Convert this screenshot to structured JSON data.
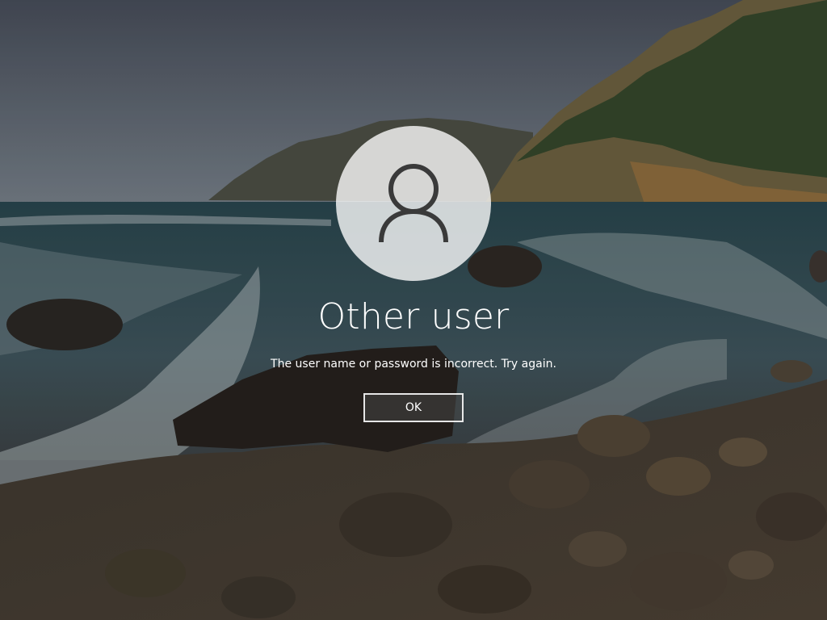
{
  "lock_screen": {
    "user_name": "Other user",
    "error_message": "The user name or password is incorrect. Try again.",
    "ok_label": "OK"
  },
  "icons": {
    "avatar": "user-silhouette-icon"
  },
  "colors": {
    "text": "#ffffff",
    "avatar_background": "#e9e9e9",
    "avatar_icon": "#3a3a3a",
    "button_border": "#ffffff"
  }
}
